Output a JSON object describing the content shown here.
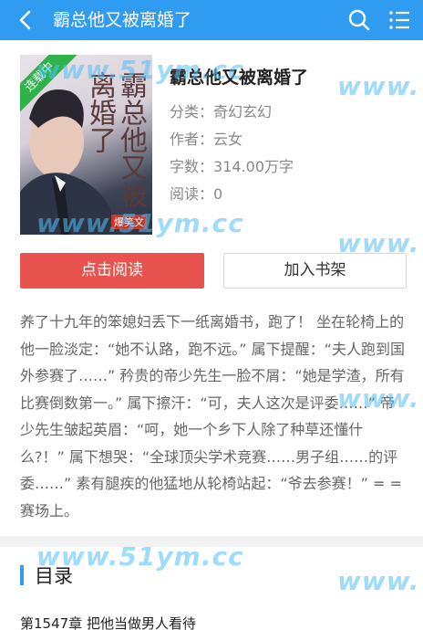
{
  "header": {
    "title": "霸总他又被离婚了",
    "back_icon": "chevron-left-icon",
    "search_icon": "search-icon",
    "menu_icon": "list-menu-icon",
    "bg_color": "#2f9cf2"
  },
  "cover": {
    "badge": "连载中",
    "cover_title": "霸总他又被离婚了",
    "publisher": "爆笑文"
  },
  "book": {
    "title": "霸总他又被离婚了",
    "category_label": "分类：",
    "category": "奇幻玄幻",
    "author_label": "作者：",
    "author": "云女",
    "words_label": "字数：",
    "words": "314.00万字",
    "reads_label": "阅读：",
    "reads": "0"
  },
  "actions": {
    "read_label": "点击阅读",
    "shelf_label": "加入书架",
    "read_color": "#e9534f"
  },
  "description": "养了十九年的笨媳妇丢下一纸离婚书，跑了！ 坐在轮椅上的他一脸淡定：“她不认路，跑不远。” 属下提醒：“夫人跑到国外参赛了……” 矜贵的帝少先生一脸不屑：“她是学渣，所有比赛倒数第一。” 属下擦汗：“可，夫人这次是评委……” 帝少先生皱起英眉：“呵，她一个乡下人除了种草还懂什么?！” 属下想哭：“全球顶尖学术竞赛……男子组……的评委……” 素有腿疾的他猛地从轮椅站起：“爷去参赛！” = = 赛场上。",
  "toc": {
    "heading": "目录",
    "first_chapter": "第1547章 把他当做男人看待"
  },
  "watermarks": [
    "www.51ym.cc",
    "www.",
    "www.",
    "www.51ym.cc",
    "www.",
    "www.51ym.cc",
    "www."
  ]
}
